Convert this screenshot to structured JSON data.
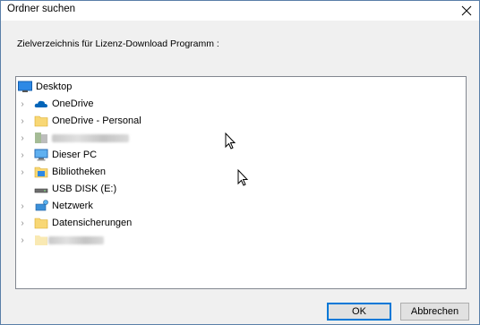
{
  "window": {
    "title": "Ordner suchen",
    "close_glyph": "✕"
  },
  "instruction": "Zielverzeichnis für Lizenz-Download Programm :",
  "tree": {
    "items": [
      {
        "label": "Desktop",
        "icon": "desktop-icon",
        "expandable": false
      },
      {
        "label": "OneDrive",
        "icon": "cloud-icon",
        "expandable": true
      },
      {
        "label": "OneDrive - Personal",
        "icon": "folder-icon",
        "expandable": true
      },
      {
        "label": "",
        "icon": "user-folder-icon",
        "expandable": true,
        "redacted": true
      },
      {
        "label": "Dieser PC",
        "icon": "computer-icon",
        "expandable": true
      },
      {
        "label": "Bibliotheken",
        "icon": "library-icon",
        "expandable": true
      },
      {
        "label": "USB DISK (E:)",
        "icon": "usb-drive-icon",
        "expandable": false
      },
      {
        "label": "Netzwerk",
        "icon": "network-icon",
        "expandable": true
      },
      {
        "label": "Datensicherungen",
        "icon": "folder-icon",
        "expandable": true
      },
      {
        "label": "",
        "icon": "folder-icon",
        "expandable": true,
        "redacted": true
      }
    ]
  },
  "buttons": {
    "ok": "OK",
    "cancel": "Abbrechen"
  },
  "colors": {
    "accent": "#0078d7",
    "folder": "#f8d775",
    "onedrive": "#0364b8"
  }
}
